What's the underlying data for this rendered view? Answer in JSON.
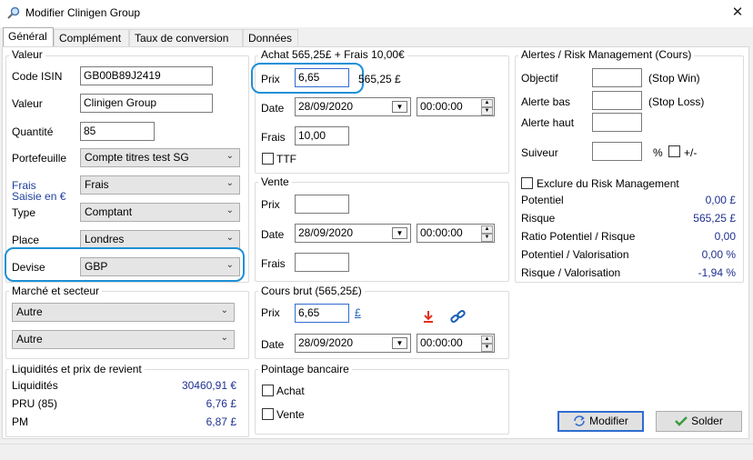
{
  "window": {
    "title": "Modifier Clinigen Group",
    "close_glyph": "✕"
  },
  "tabs": [
    {
      "label": "Général"
    },
    {
      "label": "Complément"
    },
    {
      "label": "Taux de conversion"
    },
    {
      "label": "Données"
    }
  ],
  "valeur": {
    "title": "Valeur",
    "code_isin_label": "Code ISIN",
    "code_isin": "GB00B89J2419",
    "valeur_label": "Valeur",
    "valeur": "Clinigen Group",
    "quantite_label": "Quantité",
    "quantite": "85",
    "portefeuille_label": "Portefeuille",
    "portefeuille": "Compte titres test SG",
    "frais_label_1": "Frais",
    "frais_label_2": "Saisie en €",
    "frais": "Frais",
    "type_label": "Type",
    "type": "Comptant",
    "place_label": "Place",
    "place": "Londres",
    "devise_label": "Devise",
    "devise": "GBP"
  },
  "marche": {
    "title": "Marché et secteur",
    "marche": "Autre",
    "secteur": "Autre"
  },
  "liquidites": {
    "title": "Liquidités et prix de revient",
    "rows": [
      {
        "label": "Liquidités",
        "value": "30460,91 €"
      },
      {
        "label": "PRU (85)",
        "value": "6,76 £"
      },
      {
        "label": "PM",
        "value": "6,87 £"
      }
    ]
  },
  "achat": {
    "title": "Achat 565,25£ + Frais 10,00€",
    "prix_label": "Prix",
    "prix": "6,65",
    "total": "565,25 £",
    "date_label": "Date",
    "date": "28/09/2020",
    "time": "00:00:00",
    "frais_label": "Frais",
    "frais": "10,00",
    "ttf_label": "TTF"
  },
  "vente": {
    "title": "Vente",
    "prix_label": "Prix",
    "prix": "",
    "date_label": "Date",
    "date": "28/09/2020",
    "time": "00:00:00",
    "frais_label": "Frais",
    "frais": ""
  },
  "cours": {
    "title": "Cours brut (565,25£)",
    "prix_label": "Prix",
    "prix": "6,65",
    "currency_link": "£",
    "date_label": "Date",
    "date": "28/09/2020",
    "time": "00:00:00"
  },
  "pointage": {
    "title": "Pointage bancaire",
    "achat_label": "Achat",
    "vente_label": "Vente"
  },
  "alertes": {
    "title": "Alertes / Risk Management (Cours)",
    "objectif_label": "Objectif",
    "objectif_note": "(Stop Win)",
    "alerte_bas_label": "Alerte bas",
    "alerte_bas_note": "(Stop Loss)",
    "alerte_haut_label": "Alerte haut",
    "suiveur_label": "Suiveur",
    "percent": "%",
    "plusminus": "+/-",
    "exclure_label": "Exclure du Risk Management",
    "stats": [
      {
        "label": "Potentiel",
        "value": "0,00 £"
      },
      {
        "label": "Risque",
        "value": "565,25 £"
      },
      {
        "label": "Ratio Potentiel / Risque",
        "value": "0,00"
      },
      {
        "label": "Potentiel / Valorisation",
        "value": "0,00 %"
      },
      {
        "label": "Risque / Valorisation",
        "value": "-1,94 %"
      }
    ]
  },
  "buttons": {
    "modifier": "Modifier",
    "solder": "Solder"
  },
  "colors": {
    "highlight": "#1e90d6",
    "value_blue": "#1f2f8f",
    "download_red": "#e0301e",
    "link_blue": "#1a5fb4"
  }
}
